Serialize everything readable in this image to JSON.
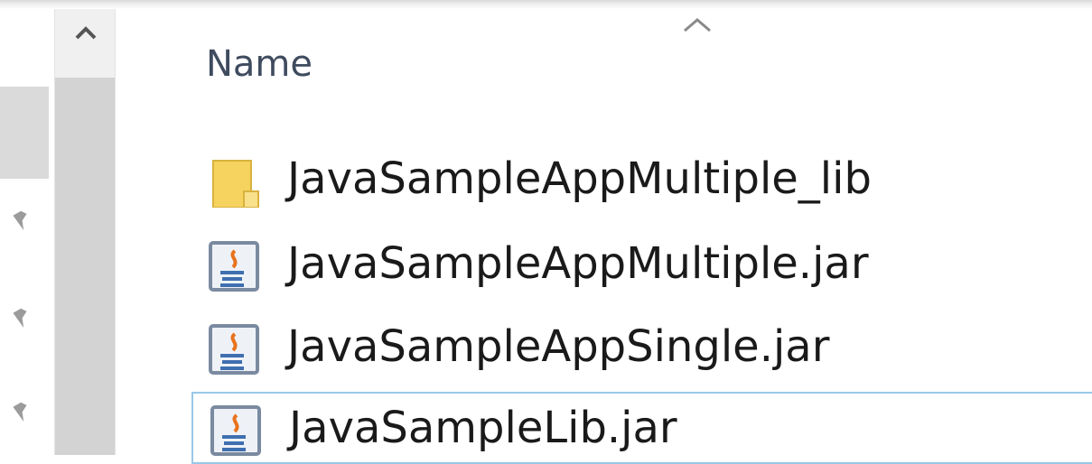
{
  "list": {
    "column_header": "Name",
    "sort_direction": "ascending",
    "items": [
      {
        "name": "JavaSampleAppMultiple_lib",
        "type": "folder",
        "icon": "folder-icon"
      },
      {
        "name": "JavaSampleAppMultiple.jar",
        "type": "jar",
        "icon": "java-jar-icon"
      },
      {
        "name": "JavaSampleAppSingle.jar",
        "type": "jar",
        "icon": "java-jar-icon"
      },
      {
        "name": "JavaSampleLib.jar",
        "type": "jar",
        "icon": "java-jar-icon",
        "focused": true
      }
    ]
  },
  "nav": {
    "pin_icon": "pin-icon",
    "scroll_up_icon": "chevron-up-icon"
  },
  "colors": {
    "folder": "#f6d25e",
    "focus_border": "#99c8e8",
    "header_text": "#3f4b5e"
  }
}
